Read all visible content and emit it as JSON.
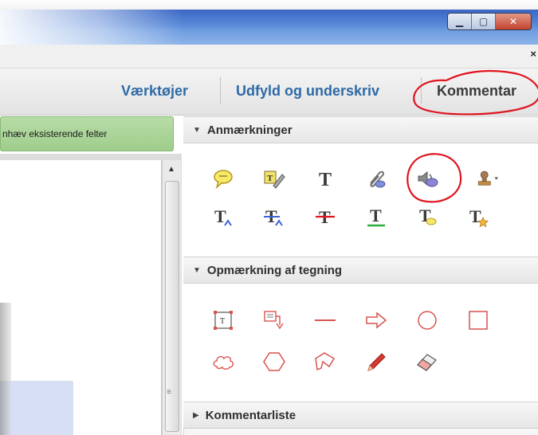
{
  "window": {
    "min_glyph": "▁",
    "max_glyph": "▢",
    "close_glyph": "✕",
    "panel_close_glyph": "×"
  },
  "toolbar": {
    "tabs": [
      "Værktøjer",
      "Udfyld og underskriv",
      "Kommentar"
    ]
  },
  "document": {
    "highlight_button": "nhæv eksisterende felter"
  },
  "panel": {
    "sections": [
      {
        "title": "Anmærkninger",
        "expanded": true
      },
      {
        "title": "Opmærkning af tegning",
        "expanded": true
      },
      {
        "title": "Kommentarliste",
        "expanded": false
      }
    ],
    "annotation_tools": [
      "sticky-note-icon",
      "highlight-text-icon",
      "add-text-icon",
      "attach-file-icon",
      "record-audio-icon",
      "stamp-icon",
      "insert-text-icon",
      "replace-text-icon",
      "strikethrough-icon",
      "underline-icon",
      "text-comment-icon",
      "add-note-to-text-icon"
    ],
    "drawing_tools": [
      "text-box-icon",
      "text-callout-icon",
      "line-icon",
      "arrow-icon",
      "oval-icon",
      "rectangle-icon",
      "cloud-icon",
      "polygon-icon",
      "connected-lines-icon",
      "pencil-icon",
      "eraser-icon"
    ]
  },
  "colors": {
    "accent_blue": "#2d6aa6",
    "highlight_green": "#a8d497",
    "annotation_red": "#e0141e",
    "markup_red": "#d9534f"
  }
}
